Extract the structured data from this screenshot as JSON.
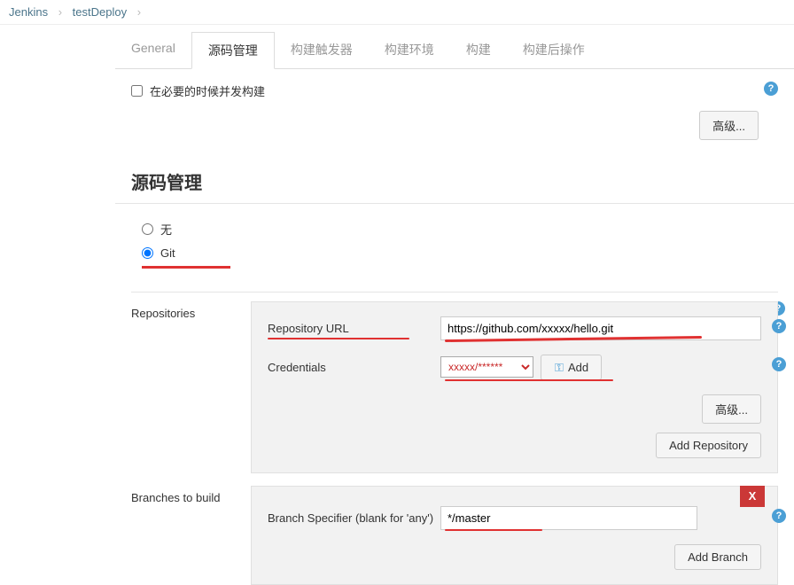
{
  "breadcrumb": {
    "root": "Jenkins",
    "project": "testDeploy"
  },
  "tabs": {
    "general": "General",
    "scm": "源码管理",
    "triggers": "构建触发器",
    "env": "构建环境",
    "build": "构建",
    "post": "构建后操作"
  },
  "concurrent": {
    "label": "在必要的时候并发构建"
  },
  "buttons": {
    "advanced": "高级...",
    "addRepo": "Add Repository",
    "addBranch": "Add Branch",
    "add": "Add"
  },
  "section": {
    "scm_title": "源码管理"
  },
  "scm_options": {
    "none": "无",
    "git": "Git",
    "selected": "git"
  },
  "repositories": {
    "title": "Repositories",
    "url_label": "Repository URL",
    "url_value": "https://github.com/xxxxx/hello.git",
    "cred_label": "Credentials",
    "cred_value": "xxxxx/******"
  },
  "branches": {
    "title": "Branches to build",
    "spec_label": "Branch Specifier (blank for 'any')",
    "spec_value": "*/master"
  }
}
